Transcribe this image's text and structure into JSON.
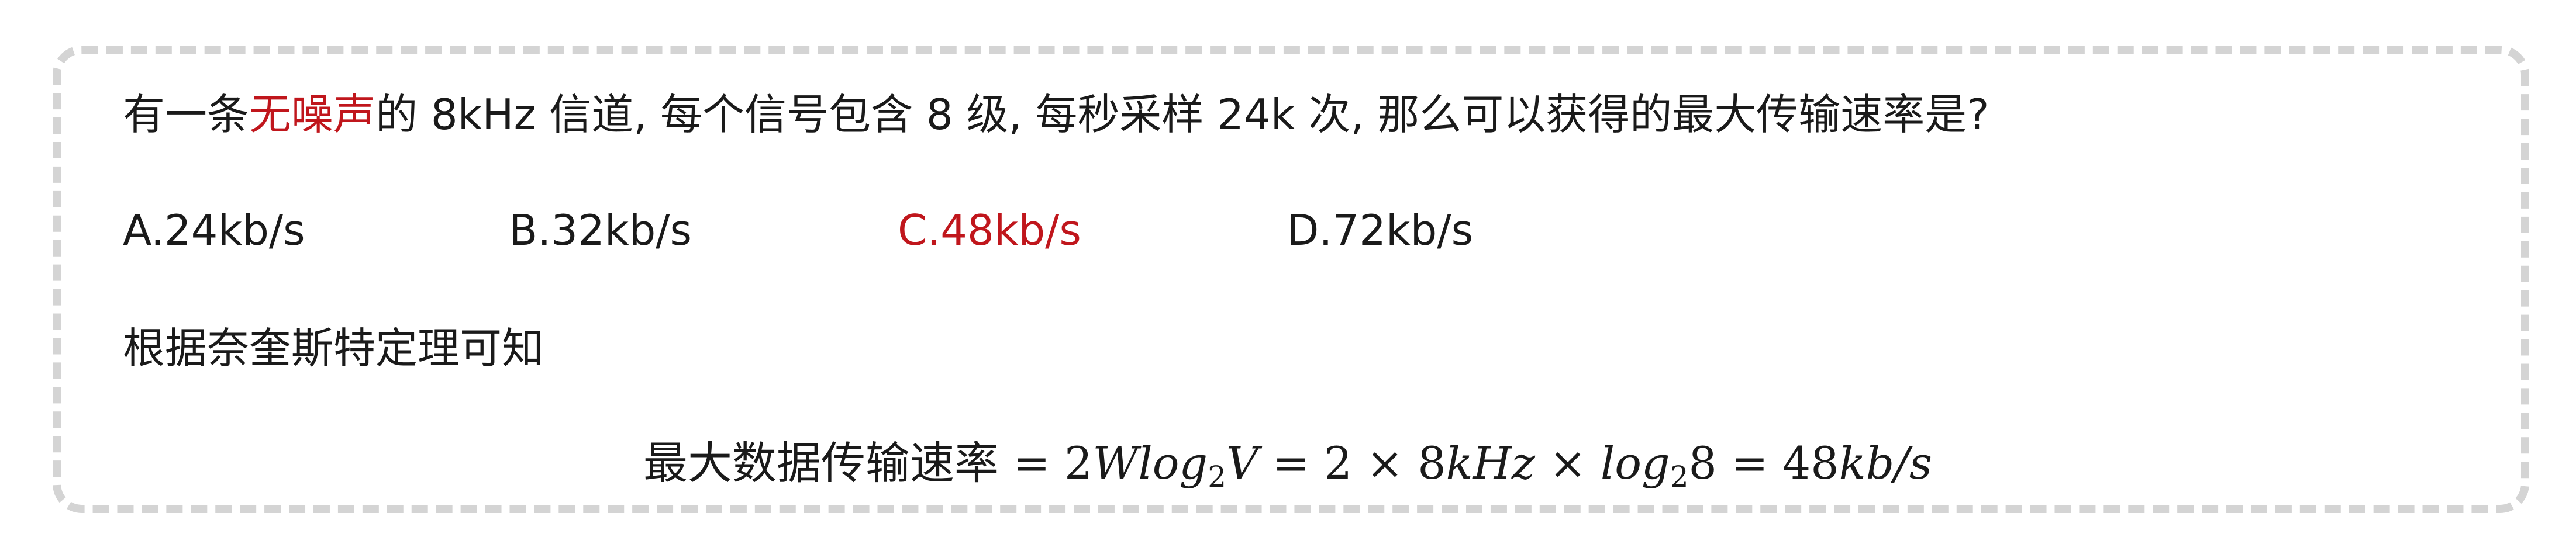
{
  "question": {
    "prefix": "有一条",
    "highlight": "无噪声",
    "suffix": "的 8kHz 信道, 每个信号包含 8 级, 每秒采样 24k 次, 那么可以获得的最大传输速率是?"
  },
  "options": [
    {
      "label": "A.24kb/s",
      "correct": false
    },
    {
      "label": "B.32kb/s",
      "correct": false
    },
    {
      "label": "C.48kb/s",
      "correct": true
    },
    {
      "label": "D.72kb/s",
      "correct": false
    }
  ],
  "explanation": "根据奈奎斯特定理可知",
  "formula": {
    "label": "最大数据传输速率",
    "eq1": " = 2",
    "w_log": "Wlog",
    "sub1": "2",
    "v": "V",
    "eq2": " = 2 × 8",
    "khz_log": "kHz",
    "times": " × ",
    "log2": "log",
    "sub2": "2",
    "eight": "8",
    "eq3": " = 48",
    "unit": "kb/s"
  },
  "colors": {
    "highlight": "#c0161c",
    "border": "#d4d4d4",
    "text": "#1a1a1a"
  }
}
